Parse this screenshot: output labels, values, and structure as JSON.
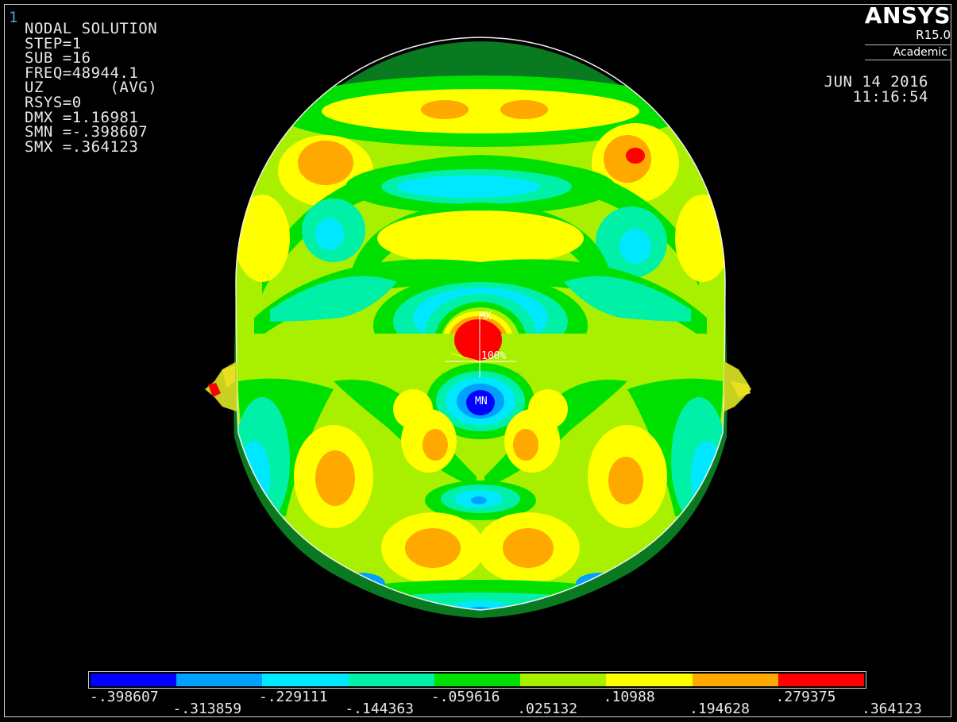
{
  "window_number": "1",
  "info_lines": [
    "NODAL SOLUTION",
    "STEP=1",
    "SUB =16",
    "FREQ=48944.1",
    "UZ       (AVG)",
    "RSYS=0",
    "DMX =1.16981",
    "SMN =-.398607",
    "SMX =.364123"
  ],
  "logo": {
    "brand": "ANSYS",
    "release": "R15.0",
    "edition": "Academic"
  },
  "date": {
    "day": "JUN 14 2016",
    "time": "11:16:54"
  },
  "markers": {
    "max": "MX",
    "min": "MN",
    "scale": "100%"
  },
  "legend": {
    "colors": [
      "#0000ff",
      "#00a0ff",
      "#00e8ff",
      "#00f0a8",
      "#00e000",
      "#a8f000",
      "#ffff00",
      "#ffa800",
      "#ff0000"
    ],
    "values": [
      ".398607",
      ".313859",
      ".229111",
      ".144363",
      ".059616",
      ".025132",
      ".10988",
      ".194628",
      ".279375",
      ".364123"
    ],
    "labels": [
      "-.398607",
      "-.313859",
      "-.229111",
      "-.144363",
      "-.059616",
      ".025132",
      ".10988",
      ".194628",
      ".279375",
      ".364123"
    ]
  }
}
